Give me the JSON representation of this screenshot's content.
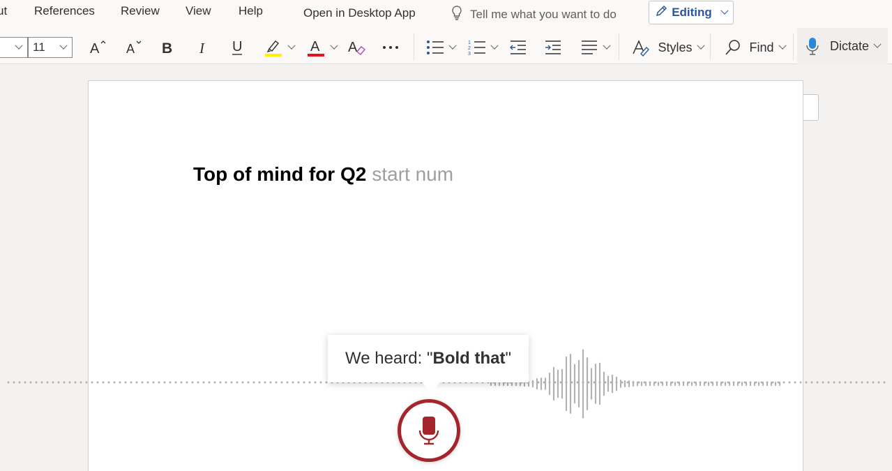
{
  "menu": {
    "items": [
      "ut",
      "References",
      "Review",
      "View",
      "Help",
      "Open in Desktop App"
    ],
    "tell_me": "Tell me what you want to do",
    "editing": "Editing"
  },
  "ribbon": {
    "font_name": "",
    "font_size": "11",
    "styles_label": "Styles",
    "find_label": "Find",
    "dictate_label": "Dictate",
    "colors": {
      "highlight": "#fff100",
      "font_color": "#e81123",
      "accent": "#2b579a",
      "mic_red": "#a4262c"
    }
  },
  "document": {
    "heading": "Top of mind for Q2",
    "interim": "start num"
  },
  "dictation": {
    "heard_prefix": "We heard: \"",
    "heard_command": "Bold that",
    "heard_suffix": "\""
  }
}
